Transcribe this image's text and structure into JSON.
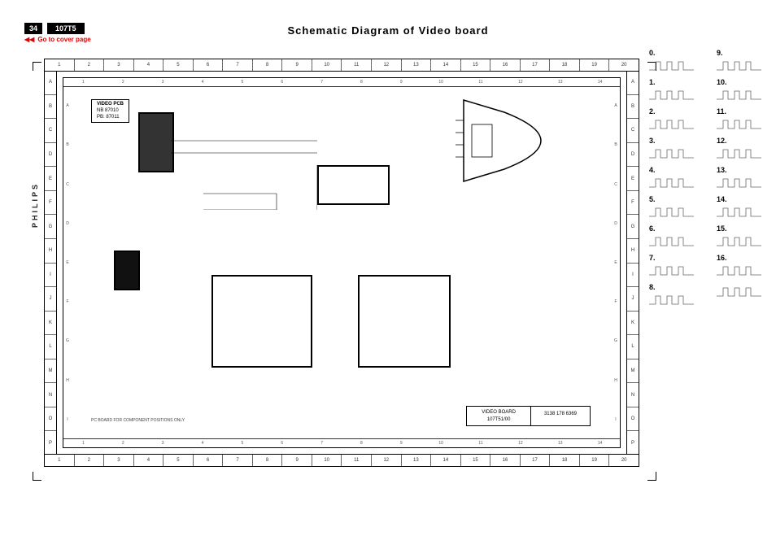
{
  "header": {
    "page_number": "34",
    "model": "107T5",
    "cover_link": "Go to cover page"
  },
  "title": "Schematic Diagram  of  Video board",
  "brand_text": "PHILIPS",
  "pcb_label": {
    "title": "VIDEO PCB",
    "line1": "NB 87010",
    "line2": "PB: 87011"
  },
  "outer_cols": [
    "1",
    "2",
    "3",
    "4",
    "5",
    "6",
    "7",
    "8",
    "9",
    "10",
    "11",
    "12",
    "13",
    "14",
    "15",
    "16",
    "17",
    "18",
    "19",
    "20"
  ],
  "outer_rows": [
    "A",
    "B",
    "C",
    "D",
    "E",
    "F",
    "G",
    "H",
    "I",
    "J",
    "K",
    "L",
    "M",
    "N",
    "O",
    "P"
  ],
  "inner_cols": [
    "1",
    "2",
    "3",
    "4",
    "5",
    "6",
    "7",
    "8",
    "9",
    "10",
    "11",
    "12",
    "13",
    "14"
  ],
  "inner_rows": [
    "A",
    "B",
    "C",
    "D",
    "E",
    "F",
    "G",
    "H",
    "I"
  ],
  "title_block": {
    "name": "VIDEO BOARD",
    "model": "107T51/00",
    "number": "3138 178 6369"
  },
  "note": "PC BOARD FOR COMPONENT POSITIONS ONLY",
  "waveforms_left": [
    "0.",
    "1.",
    "2.",
    "3.",
    "4.",
    "5.",
    "6.",
    "7.",
    "8."
  ],
  "waveforms_right": [
    "9.",
    "10.",
    "11.",
    "12.",
    "13.",
    "14.",
    "15.",
    "16."
  ]
}
